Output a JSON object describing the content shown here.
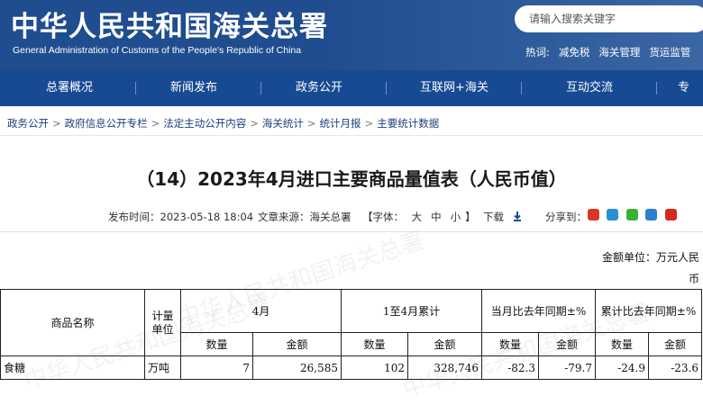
{
  "header": {
    "title_cn": "中华人民共和国海关总署",
    "title_en": "General Administration of Customs of the People's Republic of China",
    "search_placeholder": "请输入搜索关键字",
    "hot_label": "热词:",
    "hot_words": [
      "减免税",
      "海关管理",
      "货运监管"
    ]
  },
  "nav": [
    "总署概况",
    "新闻发布",
    "政务公开",
    "互联网+海关",
    "互动交流",
    "专"
  ],
  "breadcrumb": [
    "政务公开",
    "政府信息公开专栏",
    "法定主动公开内容",
    "海关统计",
    "统计月报",
    "主要统计数据"
  ],
  "article": {
    "title": "（14）2023年4月进口主要商品量值表（人民币值）",
    "publish_time": "发布时间：2023-05-18 18:04",
    "source": "文章来源：海关总署",
    "font_label": "【字体：",
    "font_large": "大",
    "font_mid": "中",
    "font_small": "小",
    "font_close": "】",
    "download": "下载",
    "share_label": "分享到："
  },
  "share_colors": [
    "#d9362a",
    "#2a8fd6",
    "#3cb034",
    "#2c7fd0",
    "#d42a1f"
  ],
  "watermark": "中华人民共和国海关总署",
  "unit_line1": "金额单位：万元人民",
  "unit_line2": "币",
  "table": {
    "col_name": "商品名称",
    "col_unit": "计量单位",
    "col_month": "4月",
    "col_ytd": "1至4月累计",
    "col_month_yoy": "当月比去年同期±%",
    "col_ytd_yoy": "累计比去年同期±%",
    "sub_qty": "数量",
    "sub_amt": "金额",
    "rows": [
      {
        "name": "食糖",
        "unit": "万吨",
        "m_qty": "7",
        "m_amt": "26,585",
        "y_qty": "102",
        "y_amt": "328,746",
        "m_qty_yoy": "-82.3",
        "m_amt_yoy": "-79.7",
        "y_qty_yoy": "-24.9",
        "y_amt_yoy": "-23.6"
      }
    ]
  }
}
